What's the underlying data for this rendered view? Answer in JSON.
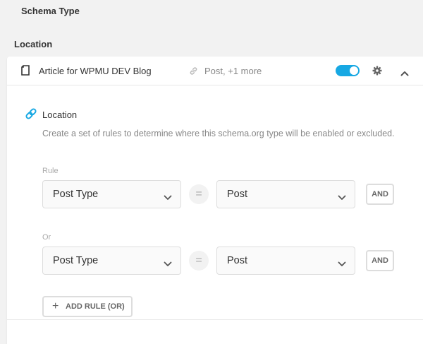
{
  "schema_type_title": "Schema Type",
  "location_section_title": "Location",
  "card": {
    "title": "Article for WPMU DEV Blog",
    "meta": "Post, +1 more",
    "toggle_on": true,
    "accent_color": "#17a8e3",
    "icons": {
      "type": "document-icon",
      "meta": "link-icon",
      "settings": "gear-icon",
      "collapse": "chevron-up-icon"
    }
  },
  "location": {
    "heading": "Location",
    "description": "Create a set of rules to determine where this schema.org type will be enabled or excluded.",
    "icon": "link-icon"
  },
  "rules": [
    {
      "label": "Rule",
      "field": "Post Type",
      "operator": "=",
      "value": "Post",
      "and_label": "AND"
    },
    {
      "label": "Or",
      "field": "Post Type",
      "operator": "=",
      "value": "Post",
      "and_label": "AND"
    }
  ],
  "add_rule_label": "ADD RULE (OR)",
  "add_rule_icon": "+"
}
